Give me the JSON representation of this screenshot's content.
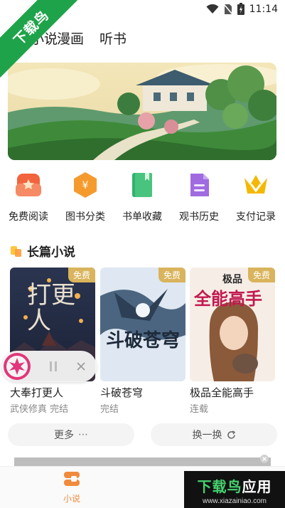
{
  "status": {
    "time": "11:14"
  },
  "watermark_corner": "下载鸟",
  "tabs": [
    {
      "label": "小说"
    },
    {
      "label": "漫画"
    },
    {
      "label": "听书"
    }
  ],
  "shortcuts": [
    {
      "label": "免费阅读",
      "icon": "free-read-icon",
      "color": "#f2643d"
    },
    {
      "label": "图书分类",
      "icon": "category-icon",
      "color": "#f59b2e"
    },
    {
      "label": "书单收藏",
      "icon": "booklist-icon",
      "color": "#2fb36b"
    },
    {
      "label": "观书历史",
      "icon": "history-icon",
      "color": "#a06be0"
    },
    {
      "label": "支付记录",
      "icon": "payment-icon",
      "color": "#f5b800"
    }
  ],
  "section": {
    "title": "长篇小说"
  },
  "books": [
    {
      "title": "大奉打更人",
      "meta": "武侠修真 完结",
      "badge": "免费",
      "cover_text": "打更人"
    },
    {
      "title": "斗破苍穹",
      "meta": "完结",
      "badge": "免费",
      "cover_text": "斗破苍穹"
    },
    {
      "title": "极品全能高手",
      "meta": "连载",
      "badge": "免费",
      "cover_text": "全能高手",
      "cover_sub": "极品"
    }
  ],
  "actions": {
    "more": "更多",
    "refresh": "换一换"
  },
  "bottom_nav": [
    {
      "label": "小说"
    }
  ],
  "watermark": {
    "main_a": "下载鸟",
    "main_b": "应用",
    "url": "www.xiazainiao.com"
  },
  "colors": {
    "accent": "#f08a3c",
    "badge": "#d9b45c"
  }
}
